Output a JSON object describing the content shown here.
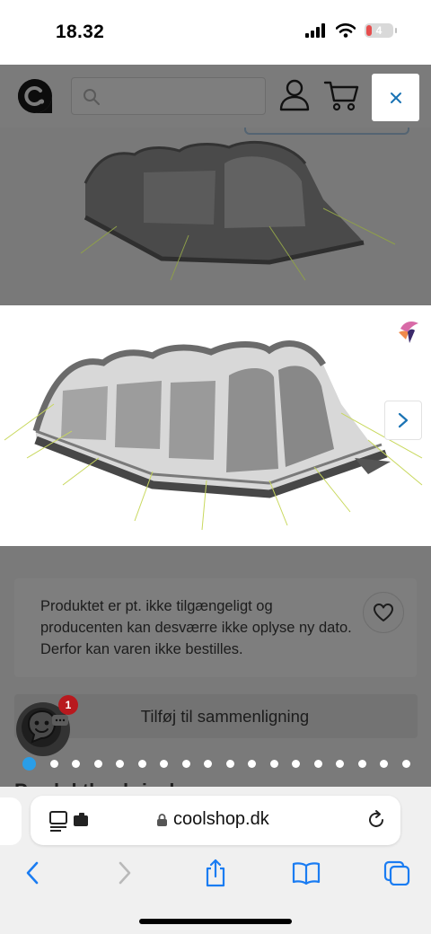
{
  "status_bar": {
    "time": "18.32",
    "battery_level": "4"
  },
  "header": {
    "search_placeholder": ""
  },
  "product": {
    "availability_notice": "Produktet er pt. ikke tilgængeligt og producenten kan desværre ikke oplyse ny dato. Derfor kan varen ikke bestilles.",
    "compare_label": "Tilføj til sammenligning",
    "carousel": {
      "total_slides": 18,
      "active_index": 0
    },
    "next_section_heading": "Produktbeskrivelse"
  },
  "chat": {
    "badge_count": "1"
  },
  "browser": {
    "url": "coolshop.dk"
  },
  "colors": {
    "accent": "#2a9ee8",
    "close_icon": "#1a73b4",
    "badge": "#b8191e",
    "safari_blue": "#1a7cf2"
  },
  "icons": [
    "logo-icon",
    "search-icon",
    "user-icon",
    "cart-icon",
    "close-icon",
    "chevron-right-icon",
    "heart-icon",
    "chat-icon",
    "lock-icon",
    "reader-icon",
    "reload-icon",
    "back-icon",
    "forward-icon",
    "share-icon",
    "bookmarks-icon",
    "tabs-icon"
  ]
}
